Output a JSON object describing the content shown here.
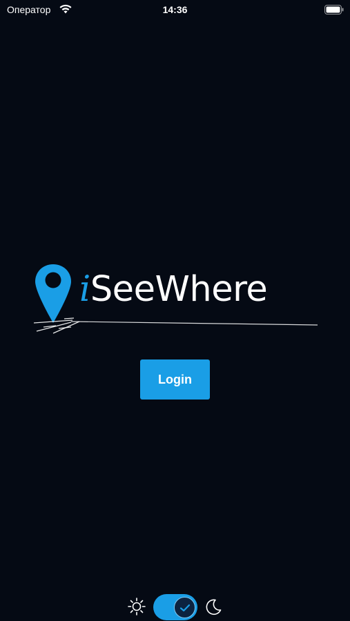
{
  "status_bar": {
    "carrier": "Оператор",
    "time": "14:36"
  },
  "logo": {
    "first_letter": "i",
    "rest": "SeeWhere",
    "pin_color": "#1a9ee6"
  },
  "login": {
    "label": "Login"
  },
  "theme": {
    "mode": "dark",
    "light_icon": "sun-icon",
    "dark_icon": "moon-icon",
    "toggle_icon": "check-icon",
    "accent": "#1a9ee6",
    "background": "#050a14"
  }
}
